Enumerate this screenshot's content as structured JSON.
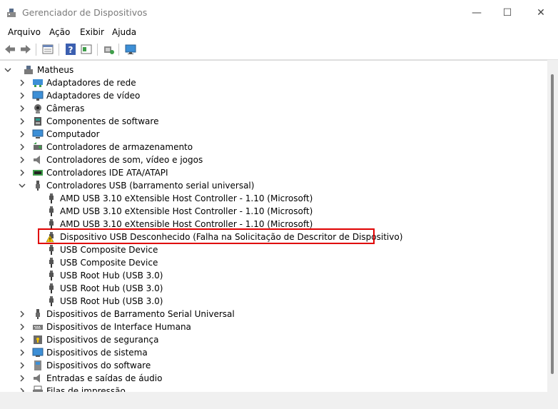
{
  "window": {
    "title": "Gerenciador de Dispositivos",
    "controls": {
      "minimize": "—",
      "maximize": "☐",
      "close": "✕"
    }
  },
  "menu": [
    "Arquivo",
    "Ação",
    "Exibir",
    "Ajuda"
  ],
  "toolbar_icons": [
    "back-arrow-icon",
    "forward-arrow-icon",
    "properties-icon",
    "help-icon",
    "view-icon",
    "scan-hardware-icon",
    "monitor-icon"
  ],
  "tree": {
    "root": "Matheus",
    "categories_before": [
      {
        "label": "Adaptadores de rede",
        "icon": "network-adapter-icon"
      },
      {
        "label": "Adaptadores de vídeo",
        "icon": "display-adapter-icon"
      },
      {
        "label": "Câmeras",
        "icon": "camera-icon"
      },
      {
        "label": "Componentes de software",
        "icon": "software-component-icon"
      },
      {
        "label": "Computador",
        "icon": "computer-icon"
      },
      {
        "label": "Controladores de armazenamento",
        "icon": "storage-controller-icon"
      },
      {
        "label": "Controladores de som, vídeo e jogos",
        "icon": "sound-icon"
      },
      {
        "label": "Controladores IDE ATA/ATAPI",
        "icon": "ide-controller-icon"
      }
    ],
    "usb_category": "Controladores USB (barramento serial universal)",
    "usb_children": [
      {
        "label": "AMD USB 3.10 eXtensible Host Controller - 1.10 (Microsoft)",
        "warning": false
      },
      {
        "label": "AMD USB 3.10 eXtensible Host Controller - 1.10 (Microsoft)",
        "warning": false
      },
      {
        "label": "AMD USB 3.10 eXtensible Host Controller - 1.10 (Microsoft)",
        "warning": false
      },
      {
        "label": "Dispositivo USB Desconhecido (Falha na Solicitação de Descritor de Dispositivo)",
        "warning": true
      },
      {
        "label": "USB Composite Device",
        "warning": false
      },
      {
        "label": "USB Composite Device",
        "warning": false
      },
      {
        "label": "USB Root Hub (USB 3.0)",
        "warning": false
      },
      {
        "label": "USB Root Hub (USB 3.0)",
        "warning": false
      },
      {
        "label": "USB Root Hub (USB 3.0)",
        "warning": false
      }
    ],
    "categories_after": [
      {
        "label": "Dispositivos de Barramento Serial Universal",
        "icon": "usb-icon"
      },
      {
        "label": "Dispositivos de Interface Humana",
        "icon": "hid-icon"
      },
      {
        "label": "Dispositivos de segurança",
        "icon": "security-device-icon"
      },
      {
        "label": "Dispositivos de sistema",
        "icon": "system-device-icon"
      },
      {
        "label": "Dispositivos do software",
        "icon": "software-device-icon"
      },
      {
        "label": "Entradas e saídas de áudio",
        "icon": "audio-io-icon"
      },
      {
        "label": "Filas de impressão",
        "icon": "print-queue-icon"
      }
    ]
  },
  "colors": {
    "highlight_border": "#e00000",
    "warning": "#f5c400"
  }
}
